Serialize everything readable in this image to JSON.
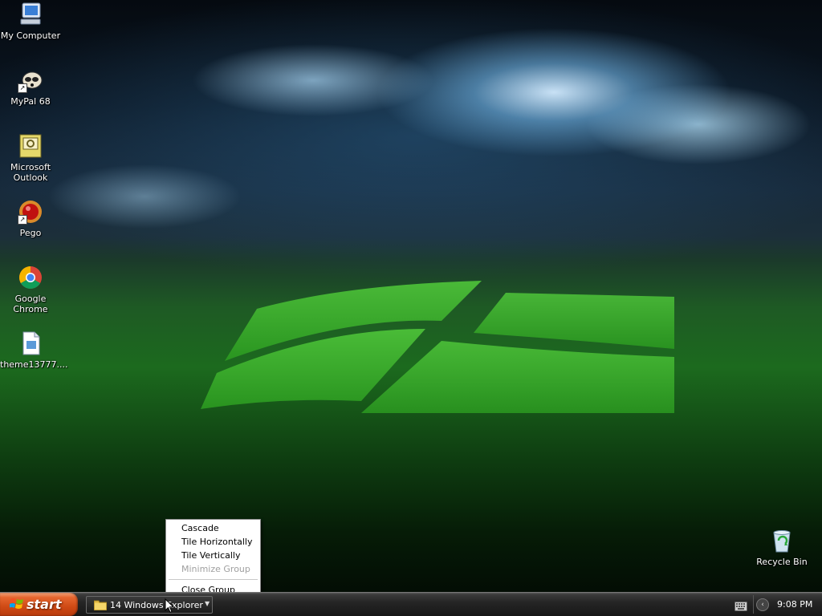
{
  "desktop": {
    "icons": [
      {
        "label": "My Computer",
        "icon": "my-computer-icon"
      },
      {
        "label": "MyPal 68",
        "icon": "mypal-icon"
      },
      {
        "label": "Microsoft Outlook",
        "icon": "outlook-icon"
      },
      {
        "label": "Pego",
        "icon": "pego-icon"
      },
      {
        "label": "Google Chrome",
        "icon": "chrome-icon"
      },
      {
        "label": "theme13777....",
        "icon": "document-icon"
      },
      {
        "label": "Recycle Bin",
        "icon": "recycle-bin-icon"
      }
    ]
  },
  "context_menu": {
    "items": [
      {
        "label": "Cascade",
        "enabled": true
      },
      {
        "label": "Tile Horizontally",
        "enabled": true
      },
      {
        "label": "Tile Vertically",
        "enabled": true
      },
      {
        "label": "Minimize Group",
        "enabled": false
      },
      {
        "label": "Close Group",
        "enabled": true
      }
    ]
  },
  "taskbar": {
    "start_label": "start",
    "task_button": {
      "label": "14 Windows Explorer",
      "icon": "folder-icon"
    },
    "clock": "9:08 PM",
    "tray_icons": [
      "keyboard-icon",
      "chevron-left-icon"
    ]
  },
  "colors": {
    "start_button": "#cf4a15",
    "taskbar": "#1e1e1e",
    "menu_background": "#ffffff",
    "menu_disabled_text": "#a0a0a0"
  }
}
